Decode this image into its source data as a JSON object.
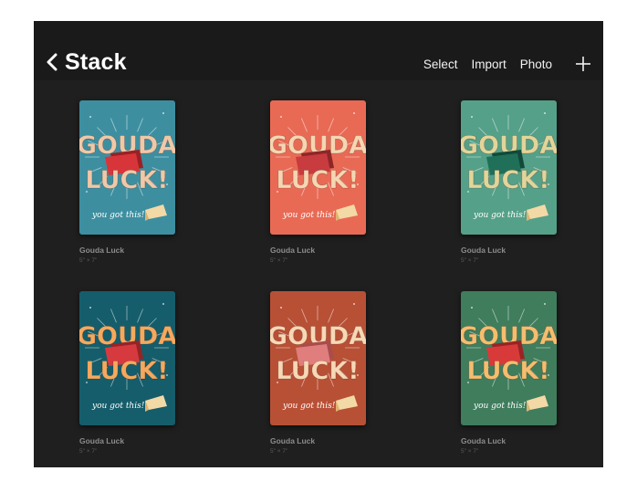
{
  "header": {
    "back_label": "Stack",
    "actions": {
      "select": "Select",
      "import": "Import",
      "photo": "Photo"
    }
  },
  "artworks": [
    {
      "name": "Gouda Luck",
      "size": "5\" × 7\"",
      "bg": "#3d8fa0",
      "letters": "#f0c8a8",
      "banner": "#d8353a",
      "banner_dark": "#9c2024"
    },
    {
      "name": "Gouda Luck",
      "size": "5\" × 7\"",
      "bg": "#e86a55",
      "letters": "#f6d6b2",
      "banner": "#c83b3e",
      "banner_dark": "#8e2628"
    },
    {
      "name": "Gouda Luck",
      "size": "5\" × 7\"",
      "bg": "#55a088",
      "letters": "#e2d59a",
      "banner": "#207059",
      "banner_dark": "#124a3a"
    },
    {
      "name": "Gouda Luck",
      "size": "5\" × 7\"",
      "bg": "#155d6b",
      "letters": "#f5a95e",
      "banner": "#d63a3e",
      "banner_dark": "#962427"
    },
    {
      "name": "Gouda Luck",
      "size": "5\" × 7\"",
      "bg": "#b85036",
      "letters": "#f7d8b6",
      "banner": "#e07e7e",
      "banner_dark": "#a94c4c"
    },
    {
      "name": "Gouda Luck",
      "size": "5\" × 7\"",
      "bg": "#3f7d5d",
      "letters": "#f5bd6e",
      "banner": "#d83a3a",
      "banner_dark": "#982424"
    }
  ],
  "art_text": {
    "line1": "GOUDA",
    "line2": "LUCK!",
    "tagline": "you got this!"
  }
}
